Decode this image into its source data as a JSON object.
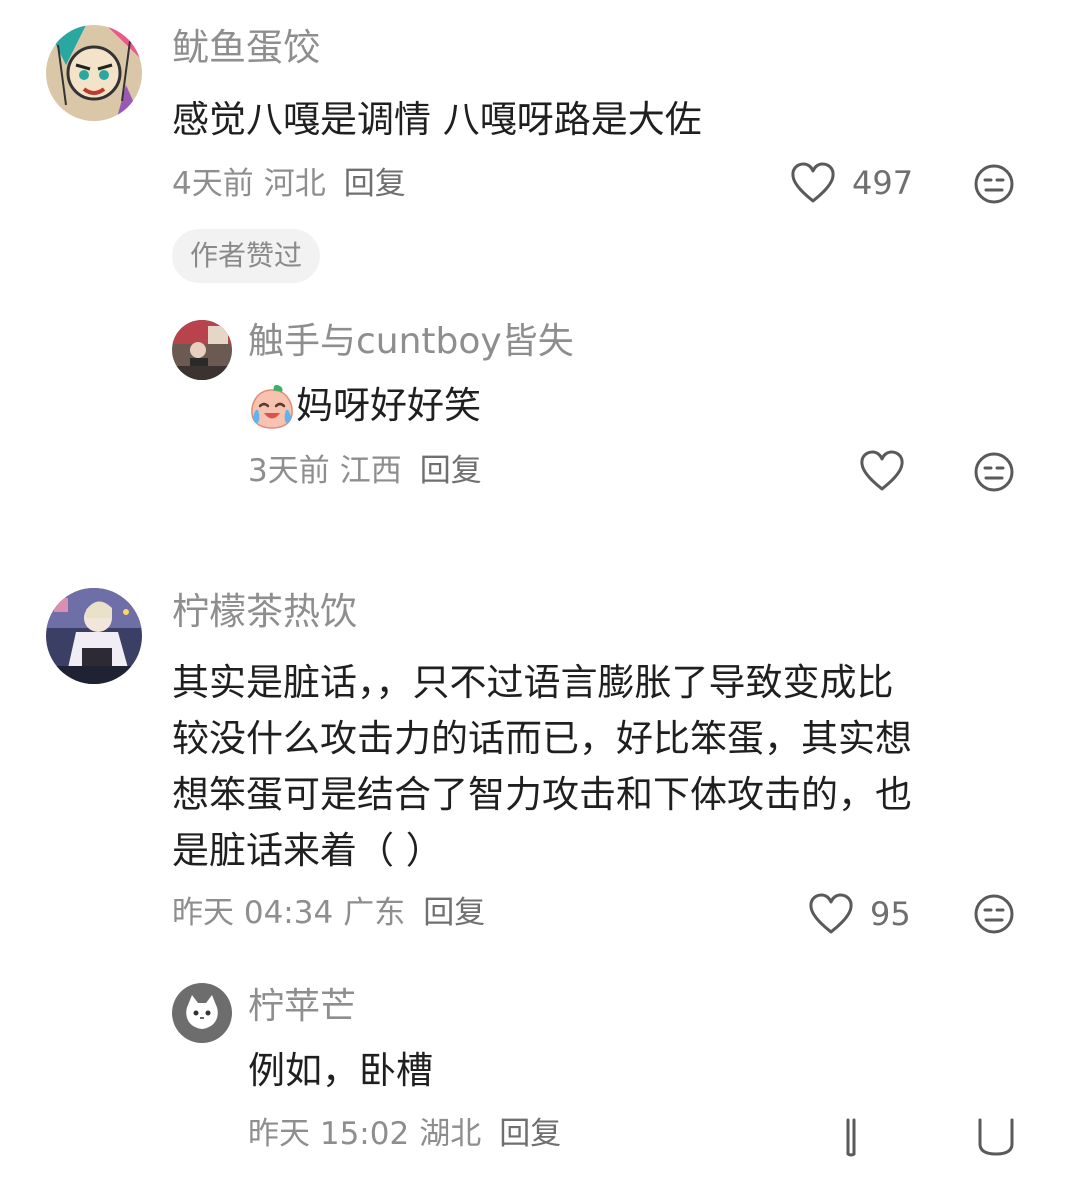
{
  "comments": [
    {
      "username": "鱿鱼蛋饺",
      "text": "感觉八嘎是调情 八嘎呀路是大佐",
      "time": "4天前",
      "location": "河北",
      "reply_label": "回复",
      "likes": "497",
      "badge": "作者赞过",
      "replies": [
        {
          "username": "触手与cuntboy皆失",
          "text": "妈呀好好笑",
          "emoji": "crying-laugh-peach",
          "time": "3天前",
          "location": "江西",
          "reply_label": "回复"
        }
      ]
    },
    {
      "username": "柠檬茶热饮",
      "text_lines": [
        "其实是脏话，，只不过语言膨胀了导致变成比",
        "较没什么攻击力的话而已，好比笨蛋，其实想",
        "想笨蛋可是结合了智力攻击和下体攻击的，也",
        "是脏话来着（ ）"
      ],
      "time": "昨天 04:34",
      "location": "广东",
      "reply_label": "回复",
      "likes": "95",
      "replies": [
        {
          "username": "柠苹芒",
          "text": "例如，卧槽",
          "time": "昨天 15:02",
          "location": "湖北",
          "reply_label": "回复"
        }
      ]
    }
  ],
  "icons": {
    "like": "heart-outline-icon",
    "dislike": "neutral-face-icon"
  },
  "colors": {
    "text": "#1f1f1f",
    "meta": "#8e8e8e",
    "badge_bg": "#f2f2f2"
  }
}
